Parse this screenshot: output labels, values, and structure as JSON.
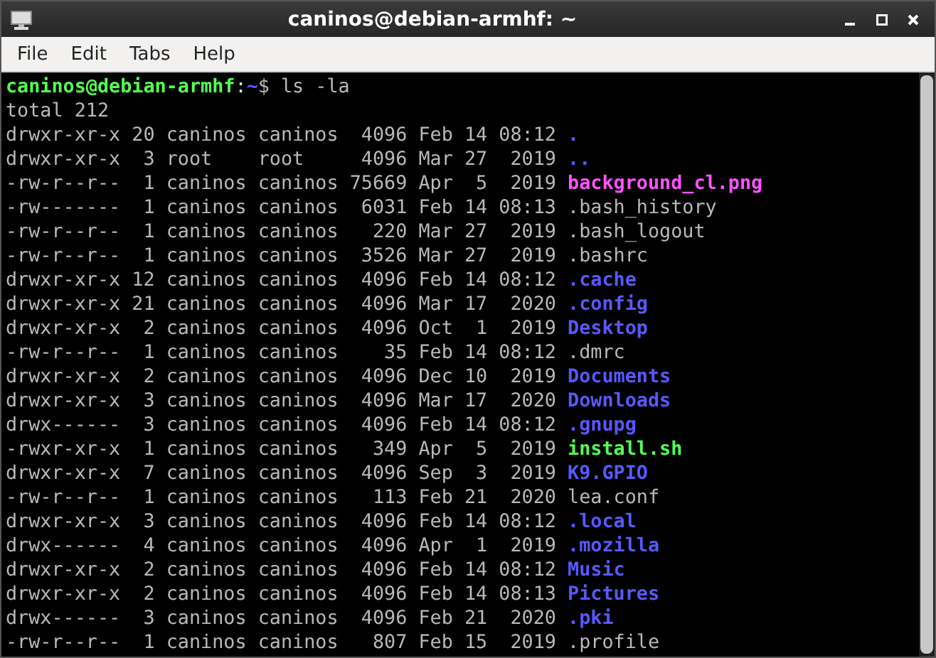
{
  "window": {
    "title": "caninos@debian-armhf: ~"
  },
  "menu": [
    "File",
    "Edit",
    "Tabs",
    "Help"
  ],
  "terminal": {
    "prompt": {
      "user_host": "caninos@debian-armhf",
      "separator": ":",
      "path": "~",
      "symbol": "$",
      "command": "ls -la"
    },
    "total": "total 212",
    "entries": [
      {
        "meta": "drwxr-xr-x 20 caninos caninos  4096 Feb 14 08:12",
        "name": ".",
        "kind": "dir"
      },
      {
        "meta": "drwxr-xr-x  3 root    root     4096 Mar 27  2019",
        "name": "..",
        "kind": "dir"
      },
      {
        "meta": "-rw-r--r--  1 caninos caninos 75669 Apr  5  2019",
        "name": "background_cl.png",
        "kind": "image"
      },
      {
        "meta": "-rw-------  1 caninos caninos  6031 Feb 14 08:13",
        "name": ".bash_history",
        "kind": "file"
      },
      {
        "meta": "-rw-r--r--  1 caninos caninos   220 Mar 27  2019",
        "name": ".bash_logout",
        "kind": "file"
      },
      {
        "meta": "-rw-r--r--  1 caninos caninos  3526 Mar 27  2019",
        "name": ".bashrc",
        "kind": "file"
      },
      {
        "meta": "drwxr-xr-x 12 caninos caninos  4096 Feb 14 08:12",
        "name": ".cache",
        "kind": "dir"
      },
      {
        "meta": "drwxr-xr-x 21 caninos caninos  4096 Mar 17  2020",
        "name": ".config",
        "kind": "dir"
      },
      {
        "meta": "drwxr-xr-x  2 caninos caninos  4096 Oct  1  2019",
        "name": "Desktop",
        "kind": "dir"
      },
      {
        "meta": "-rw-r--r--  1 caninos caninos    35 Feb 14 08:12",
        "name": ".dmrc",
        "kind": "file"
      },
      {
        "meta": "drwxr-xr-x  2 caninos caninos  4096 Dec 10  2019",
        "name": "Documents",
        "kind": "dir"
      },
      {
        "meta": "drwxr-xr-x  3 caninos caninos  4096 Mar 17  2020",
        "name": "Downloads",
        "kind": "dir"
      },
      {
        "meta": "drwx------  3 caninos caninos  4096 Feb 14 08:12",
        "name": ".gnupg",
        "kind": "dir"
      },
      {
        "meta": "-rwxr-xr-x  1 caninos caninos   349 Apr  5  2019",
        "name": "install.sh",
        "kind": "exec"
      },
      {
        "meta": "drwxr-xr-x  7 caninos caninos  4096 Sep  3  2019",
        "name": "K9.GPIO",
        "kind": "dir"
      },
      {
        "meta": "-rw-r--r--  1 caninos caninos   113 Feb 21  2020",
        "name": "lea.conf",
        "kind": "file"
      },
      {
        "meta": "drwxr-xr-x  3 caninos caninos  4096 Feb 14 08:12",
        "name": ".local",
        "kind": "dir"
      },
      {
        "meta": "drwx------  4 caninos caninos  4096 Apr  1  2019",
        "name": ".mozilla",
        "kind": "dir"
      },
      {
        "meta": "drwxr-xr-x  2 caninos caninos  4096 Feb 14 08:12",
        "name": "Music",
        "kind": "dir"
      },
      {
        "meta": "drwxr-xr-x  2 caninos caninos  4096 Feb 14 08:13",
        "name": "Pictures",
        "kind": "dir"
      },
      {
        "meta": "drwx------  3 caninos caninos  4096 Feb 21  2020",
        "name": ".pki",
        "kind": "dir"
      },
      {
        "meta": "-rw-r--r--  1 caninos caninos   807 Feb 15  2019",
        "name": ".profile",
        "kind": "file"
      }
    ]
  }
}
